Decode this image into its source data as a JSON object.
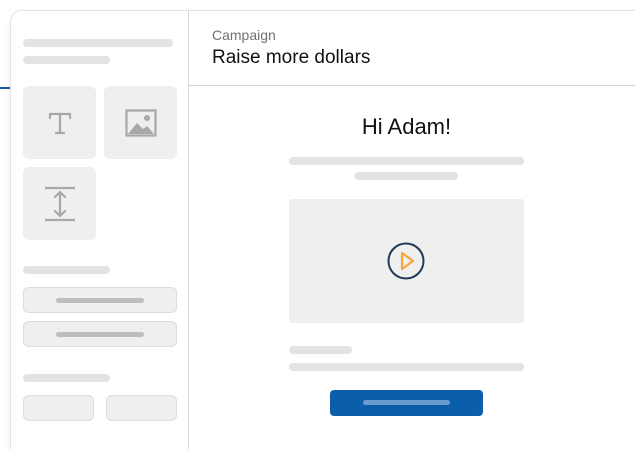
{
  "header": {
    "eyebrow": "Campaign",
    "title": "Raise more dollars"
  },
  "preview": {
    "greeting": "Hi Adam!"
  },
  "sidebar": {
    "tiles": [
      {
        "icon": "text-icon"
      },
      {
        "icon": "image-icon"
      },
      {
        "icon": "spacer-icon"
      }
    ]
  },
  "colors": {
    "accent": "#0b5faa",
    "play": "#f4a63b",
    "play_ring": "#1f3a5a",
    "skeleton": "#e3e3e3"
  }
}
